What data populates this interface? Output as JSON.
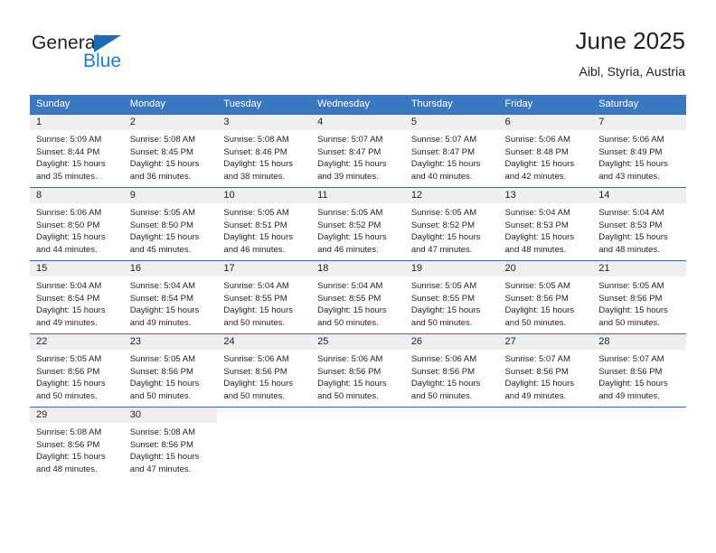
{
  "logo": {
    "text_dark": "General",
    "text_blue": "Blue",
    "triangle_color": "#1b6cb5",
    "blue_color": "#1b7fd4"
  },
  "header": {
    "title": "June 2025",
    "subtitle": "Aibl, Styria, Austria"
  },
  "theme": {
    "header_bg": "#3a79bf",
    "row_border": "#2f6fb2",
    "daynum_bg": "#efefef",
    "text": "#231f20"
  },
  "columns": [
    "Sunday",
    "Monday",
    "Tuesday",
    "Wednesday",
    "Thursday",
    "Friday",
    "Saturday"
  ],
  "weeks": [
    [
      {
        "day": "1",
        "sunrise": "Sunrise: 5:09 AM",
        "sunset": "Sunset: 8:44 PM",
        "daylight1": "Daylight: 15 hours",
        "daylight2": "and 35 minutes."
      },
      {
        "day": "2",
        "sunrise": "Sunrise: 5:08 AM",
        "sunset": "Sunset: 8:45 PM",
        "daylight1": "Daylight: 15 hours",
        "daylight2": "and 36 minutes."
      },
      {
        "day": "3",
        "sunrise": "Sunrise: 5:08 AM",
        "sunset": "Sunset: 8:46 PM",
        "daylight1": "Daylight: 15 hours",
        "daylight2": "and 38 minutes."
      },
      {
        "day": "4",
        "sunrise": "Sunrise: 5:07 AM",
        "sunset": "Sunset: 8:47 PM",
        "daylight1": "Daylight: 15 hours",
        "daylight2": "and 39 minutes."
      },
      {
        "day": "5",
        "sunrise": "Sunrise: 5:07 AM",
        "sunset": "Sunset: 8:47 PM",
        "daylight1": "Daylight: 15 hours",
        "daylight2": "and 40 minutes."
      },
      {
        "day": "6",
        "sunrise": "Sunrise: 5:06 AM",
        "sunset": "Sunset: 8:48 PM",
        "daylight1": "Daylight: 15 hours",
        "daylight2": "and 42 minutes."
      },
      {
        "day": "7",
        "sunrise": "Sunrise: 5:06 AM",
        "sunset": "Sunset: 8:49 PM",
        "daylight1": "Daylight: 15 hours",
        "daylight2": "and 43 minutes."
      }
    ],
    [
      {
        "day": "8",
        "sunrise": "Sunrise: 5:06 AM",
        "sunset": "Sunset: 8:50 PM",
        "daylight1": "Daylight: 15 hours",
        "daylight2": "and 44 minutes."
      },
      {
        "day": "9",
        "sunrise": "Sunrise: 5:05 AM",
        "sunset": "Sunset: 8:50 PM",
        "daylight1": "Daylight: 15 hours",
        "daylight2": "and 45 minutes."
      },
      {
        "day": "10",
        "sunrise": "Sunrise: 5:05 AM",
        "sunset": "Sunset: 8:51 PM",
        "daylight1": "Daylight: 15 hours",
        "daylight2": "and 46 minutes."
      },
      {
        "day": "11",
        "sunrise": "Sunrise: 5:05 AM",
        "sunset": "Sunset: 8:52 PM",
        "daylight1": "Daylight: 15 hours",
        "daylight2": "and 46 minutes."
      },
      {
        "day": "12",
        "sunrise": "Sunrise: 5:05 AM",
        "sunset": "Sunset: 8:52 PM",
        "daylight1": "Daylight: 15 hours",
        "daylight2": "and 47 minutes."
      },
      {
        "day": "13",
        "sunrise": "Sunrise: 5:04 AM",
        "sunset": "Sunset: 8:53 PM",
        "daylight1": "Daylight: 15 hours",
        "daylight2": "and 48 minutes."
      },
      {
        "day": "14",
        "sunrise": "Sunrise: 5:04 AM",
        "sunset": "Sunset: 8:53 PM",
        "daylight1": "Daylight: 15 hours",
        "daylight2": "and 48 minutes."
      }
    ],
    [
      {
        "day": "15",
        "sunrise": "Sunrise: 5:04 AM",
        "sunset": "Sunset: 8:54 PM",
        "daylight1": "Daylight: 15 hours",
        "daylight2": "and 49 minutes."
      },
      {
        "day": "16",
        "sunrise": "Sunrise: 5:04 AM",
        "sunset": "Sunset: 8:54 PM",
        "daylight1": "Daylight: 15 hours",
        "daylight2": "and 49 minutes."
      },
      {
        "day": "17",
        "sunrise": "Sunrise: 5:04 AM",
        "sunset": "Sunset: 8:55 PM",
        "daylight1": "Daylight: 15 hours",
        "daylight2": "and 50 minutes."
      },
      {
        "day": "18",
        "sunrise": "Sunrise: 5:04 AM",
        "sunset": "Sunset: 8:55 PM",
        "daylight1": "Daylight: 15 hours",
        "daylight2": "and 50 minutes."
      },
      {
        "day": "19",
        "sunrise": "Sunrise: 5:05 AM",
        "sunset": "Sunset: 8:55 PM",
        "daylight1": "Daylight: 15 hours",
        "daylight2": "and 50 minutes."
      },
      {
        "day": "20",
        "sunrise": "Sunrise: 5:05 AM",
        "sunset": "Sunset: 8:56 PM",
        "daylight1": "Daylight: 15 hours",
        "daylight2": "and 50 minutes."
      },
      {
        "day": "21",
        "sunrise": "Sunrise: 5:05 AM",
        "sunset": "Sunset: 8:56 PM",
        "daylight1": "Daylight: 15 hours",
        "daylight2": "and 50 minutes."
      }
    ],
    [
      {
        "day": "22",
        "sunrise": "Sunrise: 5:05 AM",
        "sunset": "Sunset: 8:56 PM",
        "daylight1": "Daylight: 15 hours",
        "daylight2": "and 50 minutes."
      },
      {
        "day": "23",
        "sunrise": "Sunrise: 5:05 AM",
        "sunset": "Sunset: 8:56 PM",
        "daylight1": "Daylight: 15 hours",
        "daylight2": "and 50 minutes."
      },
      {
        "day": "24",
        "sunrise": "Sunrise: 5:06 AM",
        "sunset": "Sunset: 8:56 PM",
        "daylight1": "Daylight: 15 hours",
        "daylight2": "and 50 minutes."
      },
      {
        "day": "25",
        "sunrise": "Sunrise: 5:06 AM",
        "sunset": "Sunset: 8:56 PM",
        "daylight1": "Daylight: 15 hours",
        "daylight2": "and 50 minutes."
      },
      {
        "day": "26",
        "sunrise": "Sunrise: 5:06 AM",
        "sunset": "Sunset: 8:56 PM",
        "daylight1": "Daylight: 15 hours",
        "daylight2": "and 50 minutes."
      },
      {
        "day": "27",
        "sunrise": "Sunrise: 5:07 AM",
        "sunset": "Sunset: 8:56 PM",
        "daylight1": "Daylight: 15 hours",
        "daylight2": "and 49 minutes."
      },
      {
        "day": "28",
        "sunrise": "Sunrise: 5:07 AM",
        "sunset": "Sunset: 8:56 PM",
        "daylight1": "Daylight: 15 hours",
        "daylight2": "and 49 minutes."
      }
    ],
    [
      {
        "day": "29",
        "sunrise": "Sunrise: 5:08 AM",
        "sunset": "Sunset: 8:56 PM",
        "daylight1": "Daylight: 15 hours",
        "daylight2": "and 48 minutes."
      },
      {
        "day": "30",
        "sunrise": "Sunrise: 5:08 AM",
        "sunset": "Sunset: 8:56 PM",
        "daylight1": "Daylight: 15 hours",
        "daylight2": "and 47 minutes."
      },
      {
        "day": "",
        "sunrise": "",
        "sunset": "",
        "daylight1": "",
        "daylight2": ""
      },
      {
        "day": "",
        "sunrise": "",
        "sunset": "",
        "daylight1": "",
        "daylight2": ""
      },
      {
        "day": "",
        "sunrise": "",
        "sunset": "",
        "daylight1": "",
        "daylight2": ""
      },
      {
        "day": "",
        "sunrise": "",
        "sunset": "",
        "daylight1": "",
        "daylight2": ""
      },
      {
        "day": "",
        "sunrise": "",
        "sunset": "",
        "daylight1": "",
        "daylight2": ""
      }
    ]
  ]
}
